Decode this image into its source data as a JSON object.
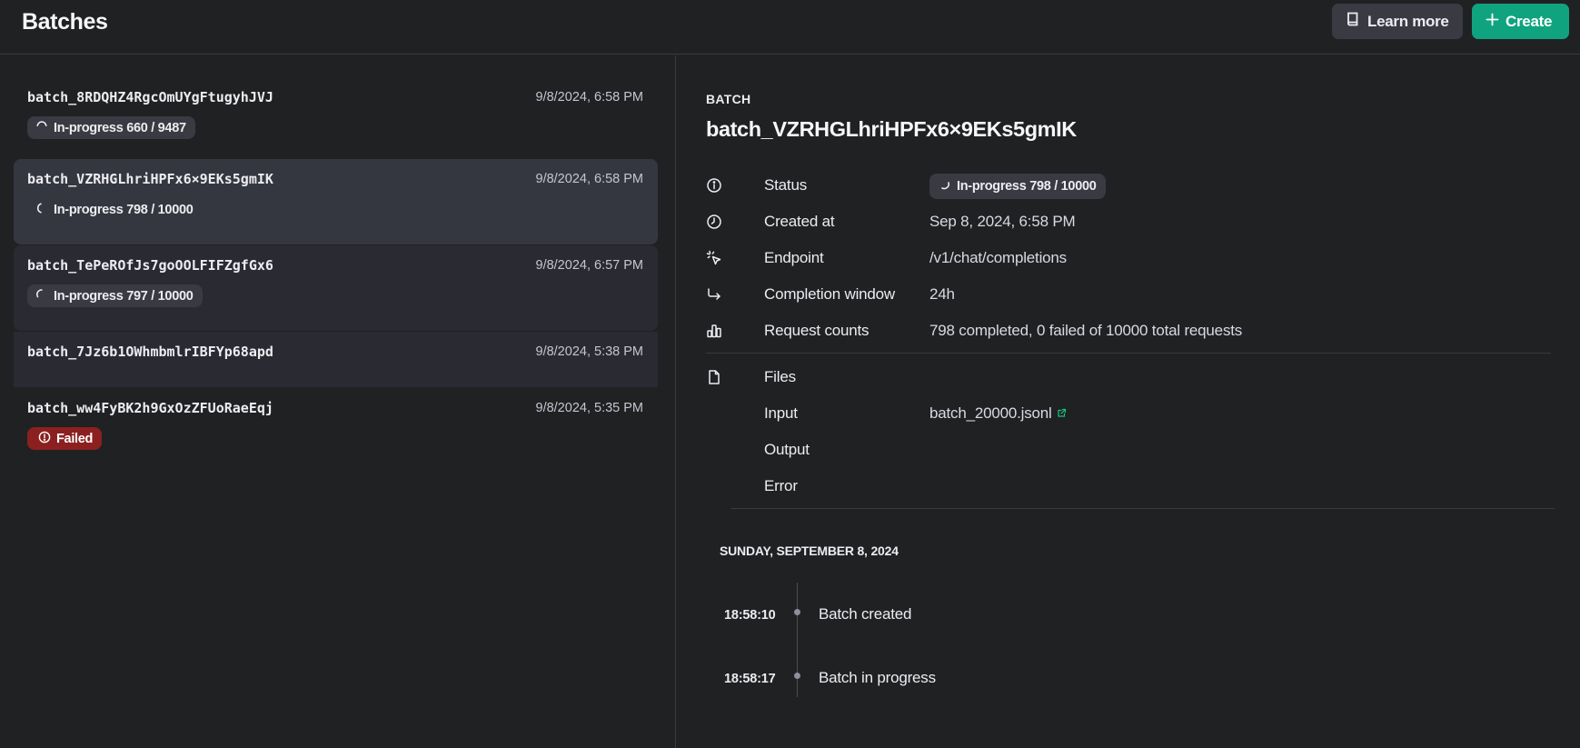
{
  "header": {
    "title": "Batches",
    "learn_more_label": "Learn more",
    "create_label": "Create",
    "accent_color": "#10a37f"
  },
  "batches": [
    {
      "id": "batch_8RDQHZ4RgcOmUYgFtugyhJVJ",
      "time": "9/8/2024, 6:58 PM",
      "status": "In-progress 660 / 9487",
      "status_kind": "in-progress"
    },
    {
      "id": "batch_VZRHGLhriHPFx6×9EKs5gmIK",
      "time": "9/8/2024, 6:58 PM",
      "status": "In-progress 798 / 10000",
      "status_kind": "in-progress",
      "selected": true
    },
    {
      "id": "batch_TePeROfJs7goOOLFIFZgfGx6",
      "time": "9/8/2024, 6:57 PM",
      "status": "In-progress 797 / 10000",
      "status_kind": "in-progress"
    },
    {
      "id": "batch_7Jz6b1OWhmbmlrIBFYp68apd",
      "time": "9/8/2024, 5:38 PM",
      "status": "",
      "status_kind": "none"
    },
    {
      "id": "batch_ww4FyBK2h9GxOzZFUoRaeEqj",
      "time": "9/8/2024, 5:35 PM",
      "status": "Failed",
      "status_kind": "failed",
      "status_color": "#8c2020"
    }
  ],
  "detail": {
    "section_label": "BATCH",
    "title": "batch_VZRHGLhriHPFx6×9EKs5gmIK",
    "status_label": "Status",
    "status_value": "In-progress 798 / 10000",
    "created_label": "Created at",
    "created_value": "Sep 8, 2024, 6:58 PM",
    "endpoint_label": "Endpoint",
    "endpoint_value": "/v1/chat/completions",
    "window_label": "Completion window",
    "window_value": "24h",
    "counts_label": "Request counts",
    "counts_value": "798 completed, 0 failed of 10000 total requests",
    "files_label": "Files",
    "input_label": "Input",
    "input_value": "batch_20000.jsonl",
    "output_label": "Output",
    "error_label": "Error"
  },
  "timeline": {
    "date": "SUNDAY, SEPTEMBER 8, 2024",
    "events": [
      {
        "time": "18:58:10",
        "text": "Batch created"
      },
      {
        "time": "18:58:17",
        "text": "Batch in progress"
      }
    ]
  },
  "icons": {
    "learn_more": "book-icon",
    "create": "plus-icon",
    "status": "info-icon",
    "created": "clock-icon",
    "endpoint": "cursor-click-icon",
    "window": "arrow-return-icon",
    "counts": "bar-chart-icon",
    "files": "file-icon",
    "input_link": "external-link-icon",
    "progress": "spinner-icon",
    "failed": "alert-circle-icon"
  }
}
